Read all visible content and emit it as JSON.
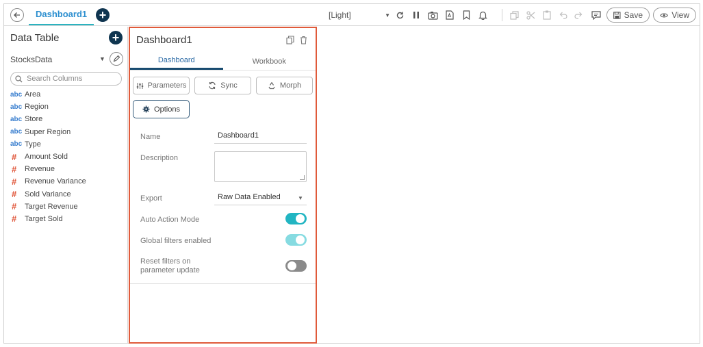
{
  "topbar": {
    "tab_label": "Dashboard1",
    "theme_select": "[Light]",
    "save_label": "Save",
    "view_label": "View"
  },
  "left_panel": {
    "title": "Data Table",
    "datasource": "StocksData",
    "search_placeholder": "Search Columns",
    "columns": [
      {
        "type": "abc",
        "name": "Area"
      },
      {
        "type": "abc",
        "name": "Region"
      },
      {
        "type": "abc",
        "name": "Store"
      },
      {
        "type": "abc",
        "name": "Super Region"
      },
      {
        "type": "abc",
        "name": "Type"
      },
      {
        "type": "#",
        "name": "Amount Sold"
      },
      {
        "type": "#",
        "name": "Revenue"
      },
      {
        "type": "#",
        "name": "Revenue Variance"
      },
      {
        "type": "#",
        "name": "Sold Variance"
      },
      {
        "type": "#",
        "name": "Target Revenue"
      },
      {
        "type": "#",
        "name": "Target Sold"
      }
    ]
  },
  "middle_panel": {
    "title": "Dashboard1",
    "tabs": [
      "Dashboard",
      "Workbook"
    ],
    "buttons": {
      "parameters": "Parameters",
      "sync": "Sync",
      "morph": "Morph",
      "options": "Options"
    },
    "properties": {
      "name_label": "Name",
      "name_value": "Dashboard1",
      "description_label": "Description",
      "export_label": "Export",
      "export_value": "Raw Data Enabled",
      "auto_action_label": "Auto Action Mode",
      "auto_action_on": true,
      "global_filters_label": "Global filters enabled",
      "global_filters_on": true,
      "reset_filters_label_1": "Reset filters on",
      "reset_filters_label_2": "parameter update",
      "reset_filters_on": false
    }
  },
  "colors": {
    "accent": "#22b5c2",
    "navy": "#0f3550",
    "highlight_border": "#e05a3a",
    "tab_blue": "#2b8ecf",
    "abc_blue": "#3a7fcf",
    "num_red": "#e0563a"
  }
}
